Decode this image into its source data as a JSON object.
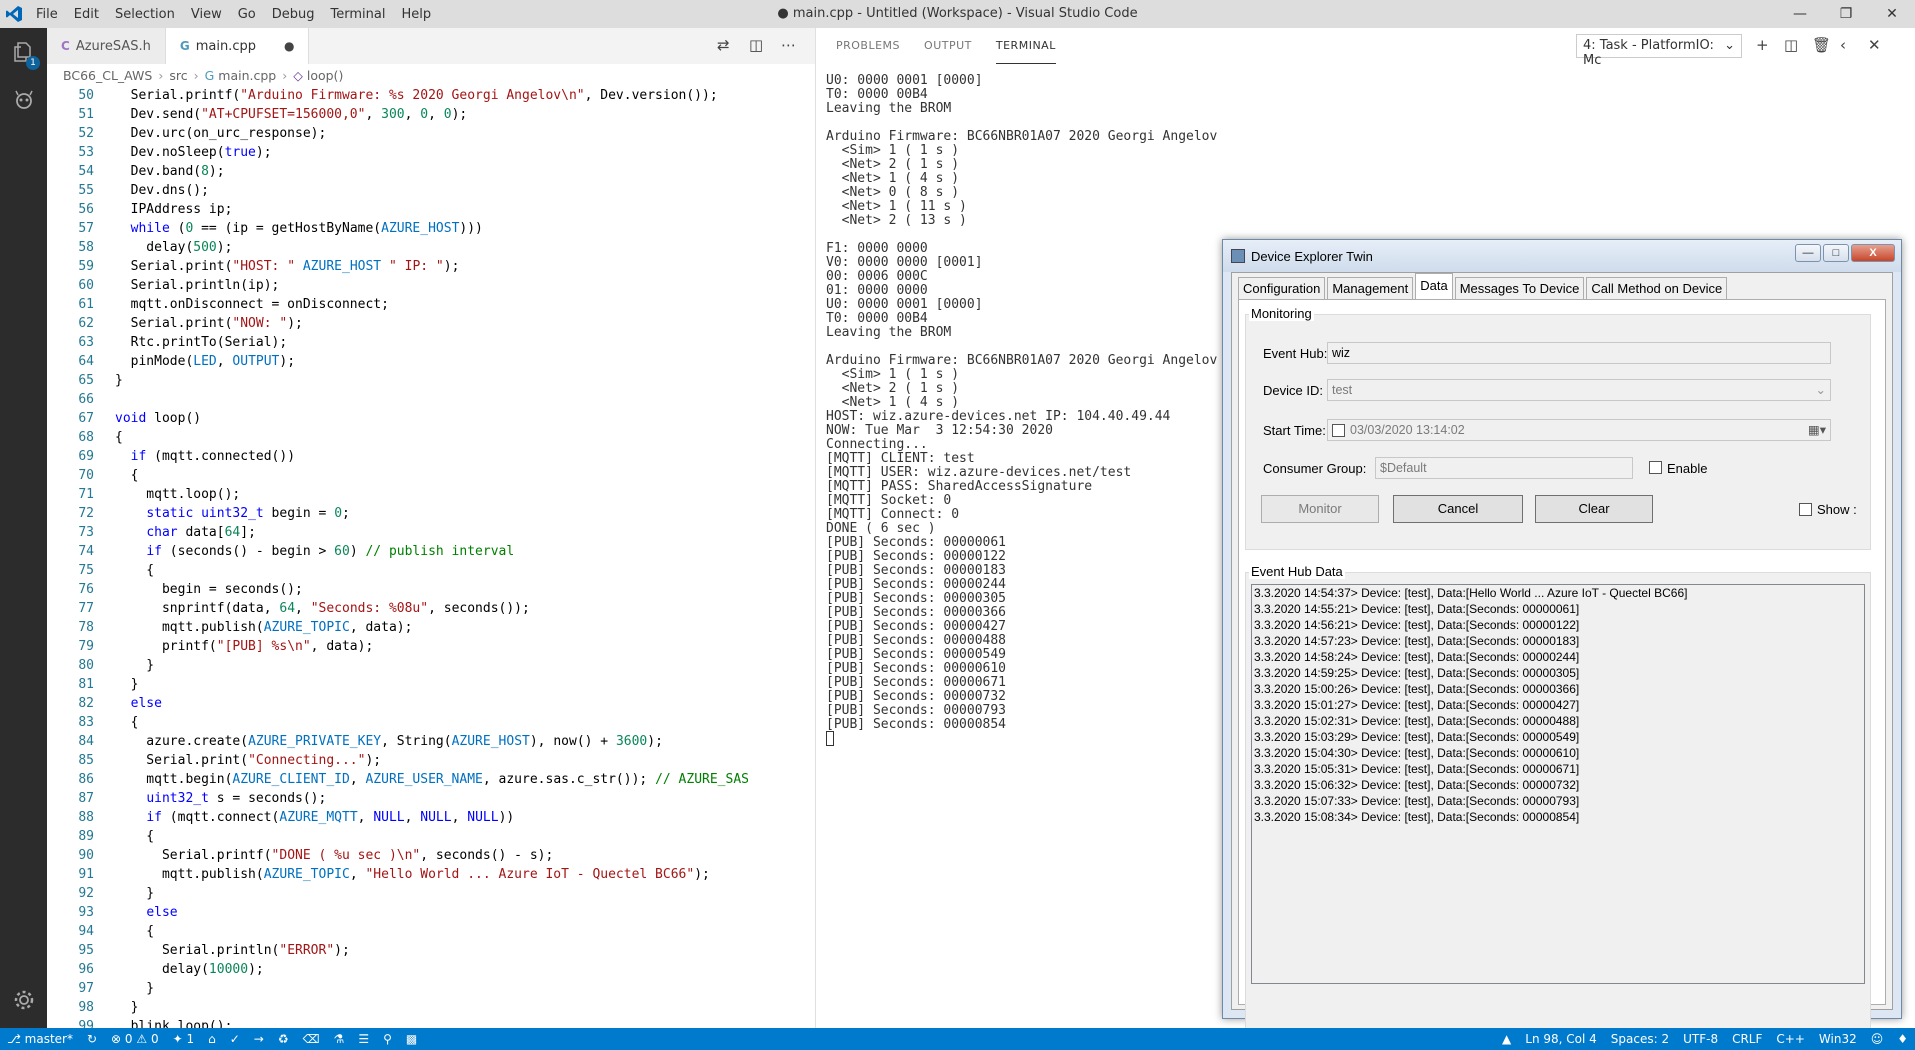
{
  "titlebar": {
    "menu": [
      "File",
      "Edit",
      "Selection",
      "View",
      "Go",
      "Debug",
      "Terminal",
      "Help"
    ],
    "title": "● main.cpp - Untitled (Workspace) - Visual Studio Code"
  },
  "editor_tabs": [
    {
      "label": "AzureSAS.h",
      "active": false
    },
    {
      "label": "main.cpp",
      "active": true,
      "dirty": "●"
    }
  ],
  "breadcrumb": [
    "BC66_CL_AWS",
    "src",
    "main.cpp",
    "loop()"
  ],
  "code": {
    "line_numbers": [
      "50",
      "51",
      "52",
      "53",
      "54",
      "55",
      "56",
      "57",
      "58",
      "59",
      "60",
      "61",
      "62",
      "63",
      "64",
      "65",
      "66",
      "67",
      "68",
      "69",
      "70",
      "71",
      "72",
      "73",
      "74",
      "75",
      "76",
      "77",
      "78",
      "79",
      "80",
      "81",
      "82",
      "83",
      "84",
      "85",
      "86",
      "87",
      "88",
      "89",
      "90",
      "91",
      "92",
      "93",
      "94",
      "95",
      "96",
      "97",
      "98",
      "99"
    ]
  },
  "panel": {
    "tabs": [
      "PROBLEMS",
      "OUTPUT",
      "TERMINAL"
    ],
    "active_tab": "TERMINAL",
    "task_select": "4: Task - PlatformIO: Mc",
    "terminal_lines": [
      "U0: 0000 0001 [0000]",
      "T0: 0000 00B4",
      "Leaving the BROM",
      "",
      "Arduino Firmware: BC66NBR01A07 2020 Georgi Angelov",
      "  <Sim> 1 ( 1 s )",
      "  <Net> 2 ( 1 s )",
      "  <Net> 1 ( 4 s )",
      "  <Net> 0 ( 8 s )",
      "  <Net> 1 ( 11 s )",
      "  <Net> 2 ( 13 s )",
      "",
      "F1: 0000 0000",
      "V0: 0000 0000 [0001]",
      "00: 0006 000C",
      "01: 0000 0000",
      "U0: 0000 0001 [0000]",
      "T0: 0000 00B4",
      "Leaving the BROM",
      "",
      "Arduino Firmware: BC66NBR01A07 2020 Georgi Angelov",
      "  <Sim> 1 ( 1 s )",
      "  <Net> 2 ( 1 s )",
      "  <Net> 1 ( 4 s )",
      "HOST: wiz.azure-devices.net IP: 104.40.49.44",
      "NOW: Tue Mar  3 12:54:30 2020",
      "Connecting...",
      "[MQTT] CLIENT: test",
      "[MQTT] USER: wiz.azure-devices.net/test",
      "[MQTT] PASS: SharedAccessSignature",
      "[MQTT] Socket: 0",
      "[MQTT] Connect: 0",
      "DONE ( 6 sec )",
      "[PUB] Seconds: 00000061",
      "[PUB] Seconds: 00000122",
      "[PUB] Seconds: 00000183",
      "[PUB] Seconds: 00000244",
      "[PUB] Seconds: 00000305",
      "[PUB] Seconds: 00000366",
      "[PUB] Seconds: 00000427",
      "[PUB] Seconds: 00000488",
      "[PUB] Seconds: 00000549",
      "[PUB] Seconds: 00000610",
      "[PUB] Seconds: 00000671",
      "[PUB] Seconds: 00000732",
      "[PUB] Seconds: 00000793",
      "[PUB] Seconds: 00000854"
    ]
  },
  "dialog": {
    "title": "Device Explorer Twin",
    "tabs": [
      "Configuration",
      "Management",
      "Data",
      "Messages To Device",
      "Call Method on Device"
    ],
    "active_tab": "Data",
    "monitoring_label": "Monitoring",
    "event_hub_label": "Event Hub:",
    "event_hub_value": "wiz",
    "device_id_label": "Device ID:",
    "device_id_value": "test",
    "start_time_label": "Start Time:",
    "start_time_value": "03/03/2020 13:14:02",
    "consumer_group_label": "Consumer Group:",
    "consumer_group_value": "$Default",
    "enable_label": "Enable",
    "monitor_button": "Monitor",
    "cancel_button": "Cancel",
    "clear_button": "Clear",
    "show_label": "Show :",
    "event_hub_data_label": "Event Hub Data",
    "event_hub_data": [
      "3.3.2020 14:54:37> Device: [test], Data:[Hello World ... Azure IoT - Quectel BC66]",
      "3.3.2020 14:55:21> Device: [test], Data:[Seconds: 00000061]",
      "3.3.2020 14:56:21> Device: [test], Data:[Seconds: 00000122]",
      "3.3.2020 14:57:23> Device: [test], Data:[Seconds: 00000183]",
      "3.3.2020 14:58:24> Device: [test], Data:[Seconds: 00000244]",
      "3.3.2020 14:59:25> Device: [test], Data:[Seconds: 00000305]",
      "3.3.2020 15:00:26> Device: [test], Data:[Seconds: 00000366]",
      "3.3.2020 15:01:27> Device: [test], Data:[Seconds: 00000427]",
      "3.3.2020 15:02:31> Device: [test], Data:[Seconds: 00000488]",
      "3.3.2020 15:03:29> Device: [test], Data:[Seconds: 00000549]",
      "3.3.2020 15:04:30> Device: [test], Data:[Seconds: 00000610]",
      "3.3.2020 15:05:31> Device: [test], Data:[Seconds: 00000671]",
      "3.3.2020 15:06:32> Device: [test], Data:[Seconds: 00000732]",
      "3.3.2020 15:07:33> Device: [test], Data:[Seconds: 00000793]",
      "3.3.2020 15:08:34> Device: [test], Data:[Seconds: 00000854]"
    ]
  },
  "statusbar": {
    "branch": "master*",
    "errors": "0",
    "warnings": "0",
    "tasks": "1",
    "position": "Ln 98, Col 4",
    "spaces": "Spaces: 2",
    "encoding": "UTF-8",
    "eol": "CRLF",
    "language": "C++",
    "platform": "Win32"
  },
  "colors": {
    "statusbar": "#007acc",
    "activitybar": "#2c2c2c",
    "keyword": "#0000ff",
    "string": "#a31515",
    "comment": "#008000"
  }
}
